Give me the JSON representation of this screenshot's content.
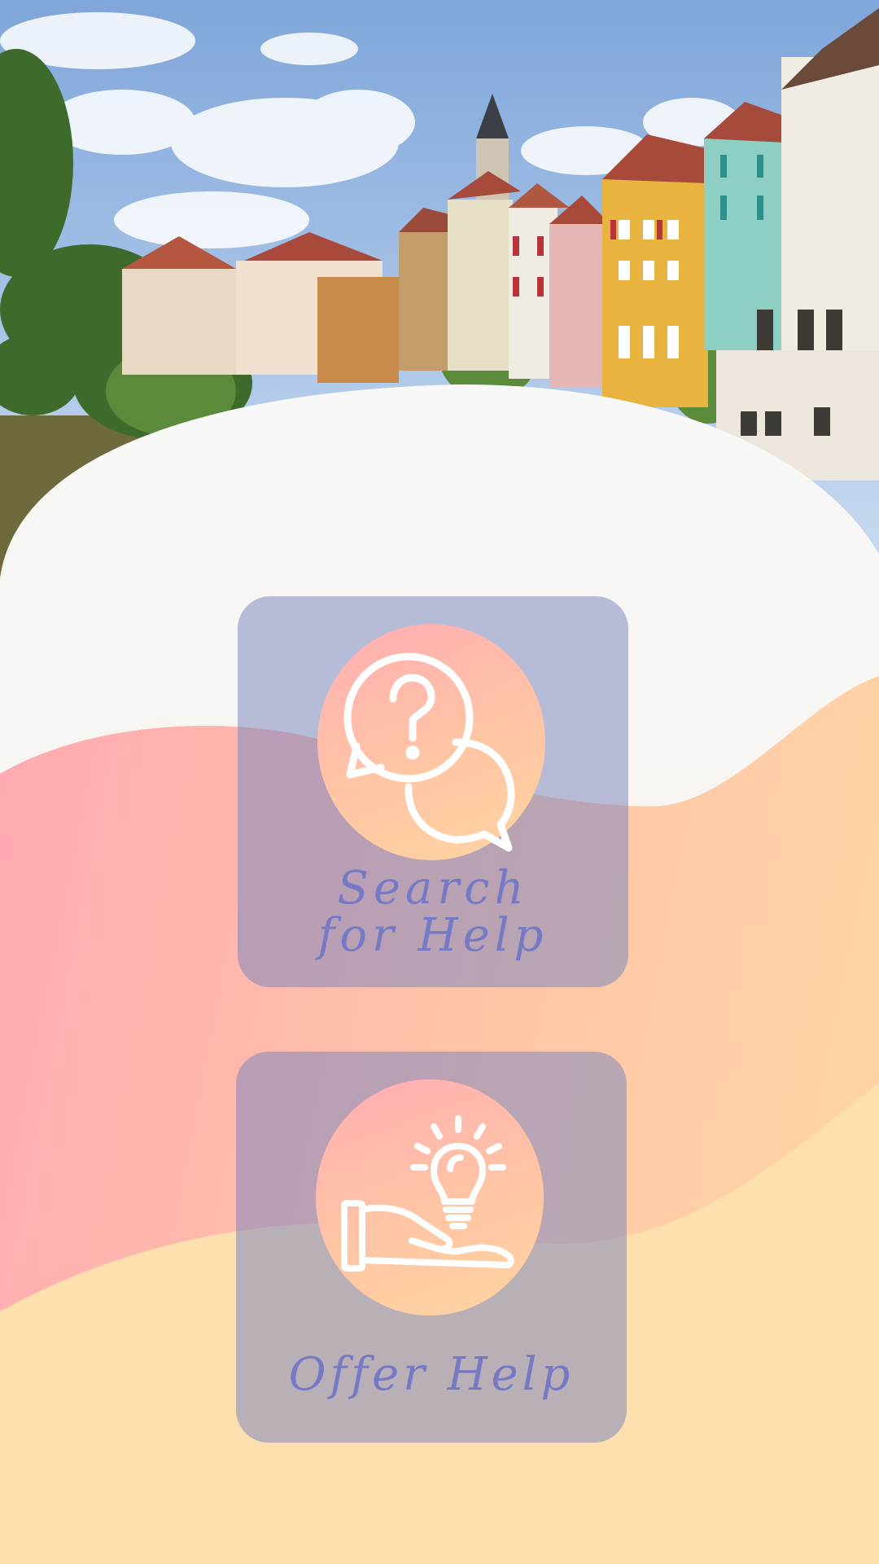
{
  "buttons": {
    "search_help": {
      "line1": "Search",
      "line2": "for Help",
      "icon": "question-chat-bubbles-icon"
    },
    "offer_help": {
      "label": "Offer Help",
      "icon": "hand-lightbulb-icon"
    }
  },
  "colors": {
    "card": "#7884be",
    "label": "#7679c4",
    "circle_start": "#ffadb3",
    "circle_end": "#ffd4a0",
    "sky": "#9ebde6",
    "background_cream": "#f8f5f2",
    "wave_pink": "#ffafb5",
    "wave_peach": "#fde0ad"
  }
}
